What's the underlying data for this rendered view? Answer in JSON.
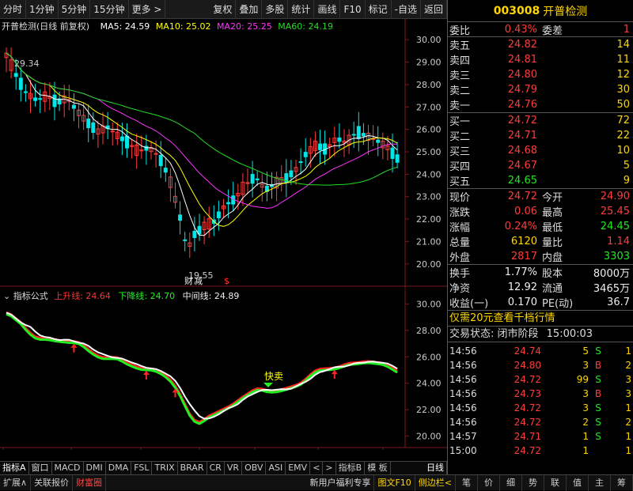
{
  "toolbar": {
    "left_items": [
      "分时",
      "1分钟",
      "5分钟",
      "15分钟",
      "更多 >"
    ],
    "right_items": [
      "复权",
      "叠加",
      "多股",
      "统计",
      "画线",
      "F10",
      "标记",
      "-自选",
      "返回"
    ]
  },
  "main_chart": {
    "title": "开普检测(日线 前复权)",
    "ma5": "MA5: 24.59",
    "ma10": "MA10: 25.02",
    "ma20": "MA20: 25.25",
    "ma60": "MA60: 24.19",
    "high_label": "29.34",
    "low_label": "19.55",
    "marker_cai": "财",
    "marker_jian": "减",
    "marker_s": "$",
    "price_ticks": [
      "30.00",
      "29.00",
      "28.00",
      "27.00",
      "26.00",
      "25.00",
      "24.00",
      "23.00",
      "22.00",
      "21.00",
      "20.00"
    ]
  },
  "indicator": {
    "name": "指标公式",
    "up": "上升线: 24.64",
    "down": "下降线: 24.70",
    "mid": "中间线: 24.89",
    "signal": "快卖",
    "ticks": [
      "30.00",
      "28.00",
      "26.00",
      "24.00",
      "22.00",
      "20.00"
    ]
  },
  "x_axis": {
    "labels": [
      "2022年",
      "3",
      "4",
      "5",
      "6",
      "7",
      "8"
    ],
    "period": "日线"
  },
  "bottom_tabs": [
    "指标A",
    "窗口",
    "MACD",
    "DMI",
    "DMA",
    "FSL",
    "TRIX",
    "BRAR",
    "CR",
    "VR",
    "OBV",
    "ASI",
    "EMV",
    "<",
    ">",
    "指标B",
    "模 板"
  ],
  "status_bar": {
    "left": [
      "扩展∧",
      "关联报价",
      "财富圈"
    ],
    "right": [
      "新用户福利专享",
      "图文F10",
      "侧边栏<",
      "笔",
      "价",
      "细",
      "势",
      "联",
      "值",
      "主",
      "筹"
    ]
  },
  "quote": {
    "code": "003008",
    "name": "开普检测",
    "weibi_label": "委比",
    "weibi": "0.43%",
    "weicha_label": "委差",
    "weicha": "1",
    "asks": [
      {
        "label": "卖五",
        "price": "24.82",
        "vol": "14"
      },
      {
        "label": "卖四",
        "price": "24.81",
        "vol": "11"
      },
      {
        "label": "卖三",
        "price": "24.80",
        "vol": "12"
      },
      {
        "label": "卖二",
        "price": "24.79",
        "vol": "30"
      },
      {
        "label": "卖一",
        "price": "24.76",
        "vol": "50"
      }
    ],
    "bids": [
      {
        "label": "买一",
        "price": "24.72",
        "vol": "72",
        "color": "red"
      },
      {
        "label": "买二",
        "price": "24.71",
        "vol": "22",
        "color": "red"
      },
      {
        "label": "买三",
        "price": "24.68",
        "vol": "10",
        "color": "red"
      },
      {
        "label": "买四",
        "price": "24.67",
        "vol": "5",
        "color": "red"
      },
      {
        "label": "买五",
        "price": "24.65",
        "vol": "9",
        "color": "grn"
      }
    ],
    "stats": [
      {
        "l1": "现价",
        "v1": "24.72",
        "c1": "red",
        "l2": "今开",
        "v2": "24.90",
        "c2": "red"
      },
      {
        "l1": "涨跌",
        "v1": "0.06",
        "c1": "red",
        "l2": "最高",
        "v2": "25.45",
        "c2": "red"
      },
      {
        "l1": "涨幅",
        "v1": "0.24%",
        "c1": "red",
        "l2": "最低",
        "v2": "24.45",
        "c2": "grn"
      },
      {
        "l1": "总量",
        "v1": "6120",
        "c1": "yel",
        "l2": "量比",
        "v2": "1.14",
        "c2": "red"
      },
      {
        "l1": "外盘",
        "v1": "2817",
        "c1": "red",
        "l2": "内盘",
        "v2": "3303",
        "c2": "grn"
      }
    ],
    "fund": [
      {
        "l1": "换手",
        "v1": "1.77%",
        "l2": "股本",
        "v2": "8000万"
      },
      {
        "l1": "净资",
        "v1": "12.92",
        "l2": "流通",
        "v2": "3465万"
      },
      {
        "l1": "收益(一)",
        "v1": "0.170",
        "l2": "PE(动)",
        "v2": "36.7"
      }
    ],
    "promo": "仅需20元查看千档行情",
    "trade_state_label": "交易状态: 闭市阶段",
    "trade_state_time": "15:00:03",
    "ticks": [
      {
        "t": "14:56",
        "p": "24.74",
        "v": "5",
        "bs": "S",
        "bc": "grn",
        "n": "1"
      },
      {
        "t": "14:56",
        "p": "24.80",
        "v": "3",
        "bs": "B",
        "bc": "red",
        "n": "2"
      },
      {
        "t": "14:56",
        "p": "24.72",
        "v": "99",
        "bs": "S",
        "bc": "grn",
        "n": "3"
      },
      {
        "t": "14:56",
        "p": "24.73",
        "v": "3",
        "bs": "B",
        "bc": "red",
        "n": "3"
      },
      {
        "t": "14:56",
        "p": "24.72",
        "v": "3",
        "bs": "S",
        "bc": "grn",
        "n": "1"
      },
      {
        "t": "14:56",
        "p": "24.72",
        "v": "2",
        "bs": "S",
        "bc": "grn",
        "n": "2"
      },
      {
        "t": "14:57",
        "p": "24.71",
        "v": "1",
        "bs": "S",
        "bc": "grn",
        "n": "1"
      },
      {
        "t": "15:00",
        "p": "24.72",
        "v": "1",
        "bs": "",
        "bc": "grn",
        "n": "1"
      }
    ]
  }
}
